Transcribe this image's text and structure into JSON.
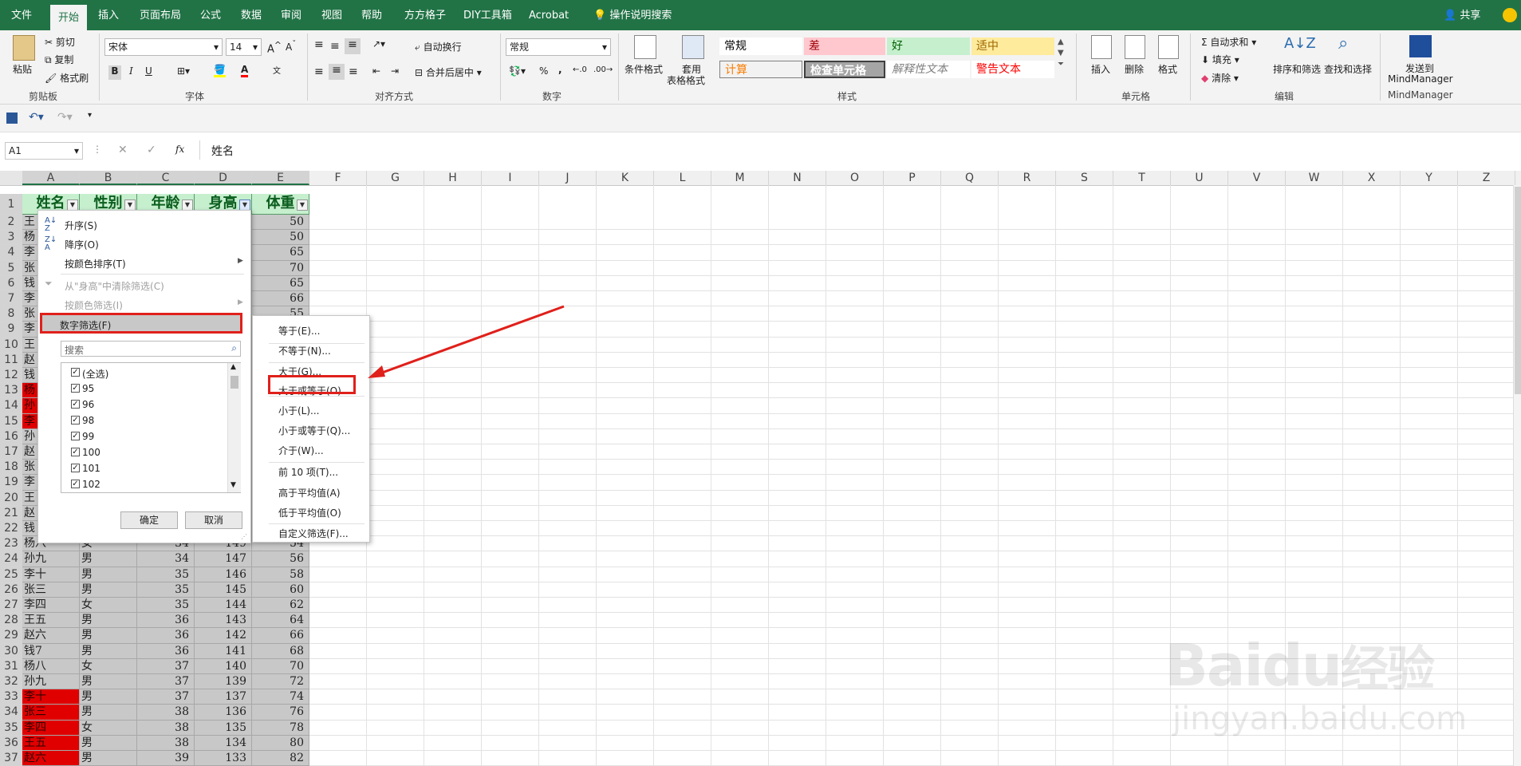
{
  "ribbon_tabs": [
    "文件",
    "开始",
    "插入",
    "页面布局",
    "公式",
    "数据",
    "审阅",
    "视图",
    "帮助",
    "方方格子",
    "DIY工具箱",
    "Acrobat",
    "操作说明搜索"
  ],
  "share_label": "共享",
  "clipboard": {
    "paste": "粘贴",
    "cut": "剪切",
    "copy": "复制",
    "format_painter": "格式刷",
    "group": "剪贴板"
  },
  "font": {
    "name": "宋体",
    "size": "14",
    "group": "字体",
    "bold": "B",
    "italic": "I",
    "underline": "U"
  },
  "alignment": {
    "wrap": "自动换行",
    "merge": "合并后居中",
    "group": "对齐方式"
  },
  "number": {
    "format": "常规",
    "percent": "%",
    "comma": ",",
    "group": "数字"
  },
  "styles": {
    "cond_format": "条件格式",
    "table_format_1": "套用",
    "table_format_2": "表格格式",
    "group": "样式",
    "cells": [
      {
        "label": "常规",
        "bg": "#ffffff",
        "color": "#000000"
      },
      {
        "label": "差",
        "bg": "#ffc7ce",
        "color": "#9c0006"
      },
      {
        "label": "好",
        "bg": "#c6efce",
        "color": "#006100"
      },
      {
        "label": "适中",
        "bg": "#ffeb9c",
        "color": "#9c6500"
      },
      {
        "label": "计算",
        "bg": "#f2f2f2",
        "color": "#fa7d00"
      },
      {
        "label": "检查单元格",
        "bg": "#a5a5a5",
        "color": "#ffffff"
      },
      {
        "label": "解释性文本",
        "bg": "#ffffff",
        "color": "#7f7f7f"
      },
      {
        "label": "警告文本",
        "bg": "#ffffff",
        "color": "#ff0000"
      }
    ]
  },
  "cells_group": {
    "insert": "插入",
    "delete": "删除",
    "format": "格式",
    "group": "单元格"
  },
  "editing": {
    "autosum": "自动求和",
    "fill": "填充",
    "clear": "清除",
    "sort_filter": "排序和筛选",
    "find_select": "查找和选择",
    "group": "编辑"
  },
  "mindmanager": {
    "send_1": "发送到",
    "send_2": "MindManager",
    "group": "MindManager"
  },
  "namebox": "A1",
  "fx": "fx",
  "formula": "姓名",
  "columns": [
    "A",
    "B",
    "C",
    "D",
    "E",
    "F",
    "G",
    "H",
    "I",
    "J",
    "K",
    "L",
    "M",
    "N",
    "O",
    "P",
    "Q",
    "R",
    "S",
    "T",
    "U",
    "V",
    "W",
    "X",
    "Y",
    "Z"
  ],
  "rows": [
    "1",
    "2",
    "3",
    "4",
    "5",
    "6",
    "7",
    "8",
    "9",
    "10",
    "11",
    "12",
    "13",
    "14",
    "15",
    "16",
    "17",
    "18",
    "19",
    "20",
    "21",
    "22",
    "23",
    "24",
    "25",
    "26",
    "27",
    "28",
    "29",
    "30",
    "31",
    "32",
    "33",
    "34",
    "35",
    "36",
    "37"
  ],
  "headers": [
    "姓名",
    "性别",
    "年龄",
    "身高",
    "体重"
  ],
  "visible_a_fragments": [
    "王",
    "杨",
    "李",
    "张",
    "钱",
    "李",
    "张",
    "李",
    "王",
    "赵",
    "钱",
    "杨",
    "孙",
    "李",
    "孙",
    "赵",
    "张",
    "李",
    "王",
    "赵",
    "钱"
  ],
  "visible_weights_top": [
    "50",
    "50",
    "65",
    "70",
    "65",
    "66",
    "55"
  ],
  "table_rows": [
    {
      "row": "23",
      "name": "杨八",
      "sex": "女",
      "age": "34",
      "height": "149",
      "weight": "54"
    },
    {
      "row": "24",
      "name": "孙九",
      "sex": "男",
      "age": "34",
      "height": "147",
      "weight": "56"
    },
    {
      "row": "25",
      "name": "李十",
      "sex": "男",
      "age": "35",
      "height": "146",
      "weight": "58"
    },
    {
      "row": "26",
      "name": "张三",
      "sex": "男",
      "age": "35",
      "height": "145",
      "weight": "60"
    },
    {
      "row": "27",
      "name": "李四",
      "sex": "女",
      "age": "35",
      "height": "144",
      "weight": "62"
    },
    {
      "row": "28",
      "name": "王五",
      "sex": "男",
      "age": "36",
      "height": "143",
      "weight": "64"
    },
    {
      "row": "29",
      "name": "赵六",
      "sex": "男",
      "age": "36",
      "height": "142",
      "weight": "66"
    },
    {
      "row": "30",
      "name": "钱7",
      "sex": "男",
      "age": "36",
      "height": "141",
      "weight": "68"
    },
    {
      "row": "31",
      "name": "杨八",
      "sex": "女",
      "age": "37",
      "height": "140",
      "weight": "70"
    },
    {
      "row": "32",
      "name": "孙九",
      "sex": "男",
      "age": "37",
      "height": "139",
      "weight": "72"
    },
    {
      "row": "33",
      "name": "李十",
      "sex": "男",
      "age": "37",
      "height": "137",
      "weight": "74"
    },
    {
      "row": "34",
      "name": "张三",
      "sex": "男",
      "age": "38",
      "height": "136",
      "weight": "76"
    },
    {
      "row": "35",
      "name": "李四",
      "sex": "女",
      "age": "38",
      "height": "135",
      "weight": "78"
    },
    {
      "row": "36",
      "name": "王五",
      "sex": "男",
      "age": "38",
      "height": "134",
      "weight": "80"
    },
    {
      "row": "37",
      "name": "赵六",
      "sex": "男",
      "age": "39",
      "height": "133",
      "weight": "82"
    }
  ],
  "filter_menu": {
    "sort_asc": "升序(S)",
    "sort_desc": "降序(O)",
    "sort_by_color": "按颜色排序(T)",
    "clear_filter": "从\"身高\"中清除筛选(C)",
    "filter_by_color": "按颜色筛选(I)",
    "number_filter": "数字筛选(F)",
    "search_placeholder": "搜索",
    "checklist": [
      "(全选)",
      "95",
      "96",
      "98",
      "99",
      "100",
      "101",
      "102"
    ],
    "ok": "确定",
    "cancel": "取消"
  },
  "number_filter_menu": [
    "等于(E)...",
    "不等于(N)...",
    "大于(G)...",
    "大于或等于(O)...",
    "小于(L)...",
    "小于或等于(Q)...",
    "介于(W)...",
    "前 10 项(T)...",
    "高于平均值(A)",
    "低于平均值(O)",
    "自定义筛选(F)..."
  ],
  "watermark": {
    "brand": "Bai",
    "brand2": "du",
    "cn": "经验",
    "url": "jingyan.baidu.com"
  },
  "accent_color": "#217346",
  "highlight_color": "#e0201b"
}
